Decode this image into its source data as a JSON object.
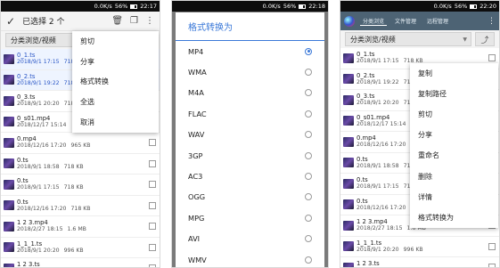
{
  "status_bars": [
    {
      "text": "0.0K/s",
      "signal": "56%",
      "time": "22:17"
    },
    {
      "text": "0.0K/s",
      "signal": "56%",
      "time": "22:18"
    },
    {
      "text": "0.0K/s",
      "signal": "56%",
      "time": "22:20"
    }
  ],
  "screen1": {
    "title": "已选择 2 个",
    "category": "分类浏览/视频",
    "menu": [
      "剪切",
      "分享",
      "格式转换",
      "全选",
      "取消"
    ],
    "files": [
      {
        "name": "0_1.ts",
        "date": "2018/9/1 17:15",
        "size": "718 KB",
        "selected": true
      },
      {
        "name": "0_2.ts",
        "date": "2018/9/1 19:22",
        "size": "718 KB",
        "selected": true
      },
      {
        "name": "0_3.ts",
        "date": "2018/9/1 20:20",
        "size": "718 KB",
        "selected": false
      },
      {
        "name": "0_s01.mp4",
        "date": "2018/12/17 15:14",
        "size": "",
        "selected": false
      },
      {
        "name": "0.mp4",
        "date": "2018/12/16 17:20",
        "size": "965 KB",
        "selected": false
      },
      {
        "name": "0.ts",
        "date": "2018/9/1 18:58",
        "size": "718 KB",
        "selected": false
      },
      {
        "name": "0.ts",
        "date": "2018/9/1 17:15",
        "size": "718 KB",
        "selected": false
      },
      {
        "name": "0.ts",
        "date": "2018/12/16 17:20",
        "size": "718 KB",
        "selected": false
      },
      {
        "name": "1 2 3.mp4",
        "date": "2018/2/27 18:15",
        "size": "1.6 MB",
        "selected": false
      },
      {
        "name": "1_1_1.ts",
        "date": "2018/9/1 20:20",
        "size": "996 KB",
        "selected": false
      },
      {
        "name": "1 2 3.ts",
        "date": "",
        "size": "",
        "selected": false
      }
    ]
  },
  "screen2": {
    "dialog_title": "格式转换为",
    "formats": [
      "MP4",
      "WMA",
      "M4A",
      "FLAC",
      "WAV",
      "3GP",
      "AC3",
      "OGG",
      "MPG",
      "AVI",
      "WMV"
    ],
    "selected_format": "MP4"
  },
  "screen3": {
    "tabs": [
      "分类浏览",
      "文件管理",
      "远程管理"
    ],
    "category": "分类浏览/视频",
    "menu": [
      "复制",
      "复制路径",
      "剪切",
      "分享",
      "重命名",
      "删除",
      "详情",
      "格式转换为"
    ],
    "files": [
      {
        "name": "0_1.ts",
        "date": "2018/9/1 17:15",
        "size": "718 KB"
      },
      {
        "name": "0_2.ts",
        "date": "2018/9/1 19:22",
        "size": "718 KB"
      },
      {
        "name": "0_3.ts",
        "date": "2018/9/1 20:20",
        "size": "718 KB"
      },
      {
        "name": "0_s01.mp4",
        "date": "2018/12/17 15:14",
        "size": ""
      },
      {
        "name": "0.mp4",
        "date": "2018/12/16 17:20",
        "size": "965 KB"
      },
      {
        "name": "0.ts",
        "date": "2018/9/1 18:58",
        "size": "718 KB"
      },
      {
        "name": "0.ts",
        "date": "2018/9/1 17:15",
        "size": "718 KB"
      },
      {
        "name": "0.ts",
        "date": "2018/12/16 17:20",
        "size": "718 KB"
      },
      {
        "name": "1 2 3.mp4",
        "date": "2018/2/27 18:15",
        "size": "1.6 MB"
      },
      {
        "name": "1_1_1.ts",
        "date": "2018/9/1 20:20",
        "size": "996 KB"
      },
      {
        "name": "1 2 3.ts",
        "date": "",
        "size": ""
      }
    ]
  },
  "colors": {
    "accent": "#3a78d8",
    "header": "#4d6374",
    "selected_text": "#2a56c6"
  }
}
